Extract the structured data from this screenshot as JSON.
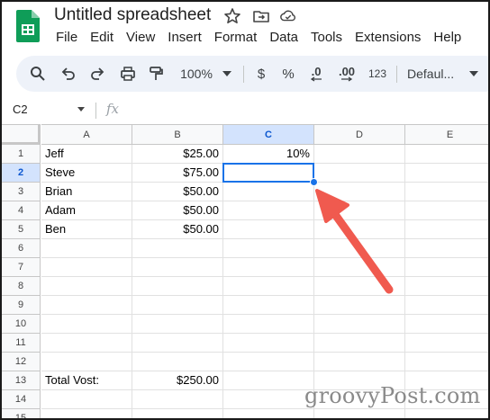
{
  "app": {
    "title": "Untitled spreadsheet",
    "menu": [
      "File",
      "Edit",
      "View",
      "Insert",
      "Format",
      "Data",
      "Tools",
      "Extensions",
      "Help"
    ]
  },
  "toolbar": {
    "zoom": "100%",
    "currency": "$",
    "percent": "%",
    "decrease_decimal": ".0",
    "increase_decimal": ".00",
    "number_format": "123",
    "font": "Defaul..."
  },
  "formula_bar": {
    "name_box": "C2",
    "fx": "fx",
    "content": ""
  },
  "grid": {
    "columns": [
      "A",
      "B",
      "C",
      "D",
      "E"
    ],
    "rows": [
      "1",
      "2",
      "3",
      "4",
      "5",
      "6",
      "7",
      "8",
      "9",
      "10",
      "11",
      "12",
      "13",
      "14",
      "15"
    ],
    "selected_column": "C",
    "selected_row": "2",
    "cells": {
      "A1": "Jeff",
      "B1": "$25.00",
      "C1": "10%",
      "A2": "Steve",
      "B2": "$75.00",
      "A3": "Brian",
      "B3": "$50.00",
      "A4": "Adam",
      "B4": "$50.00",
      "A5": "Ben",
      "B5": "$50.00",
      "A13": "Total Vost:",
      "B13": "$250.00"
    }
  },
  "colors": {
    "selection": "#1a73e8",
    "arrow": "#f05a4f",
    "selected_header_bg": "#d3e3fd",
    "toolbar_bg": "#eef2f9",
    "sheets_green": "#0f9d58"
  },
  "watermark": "groovyPost.com"
}
